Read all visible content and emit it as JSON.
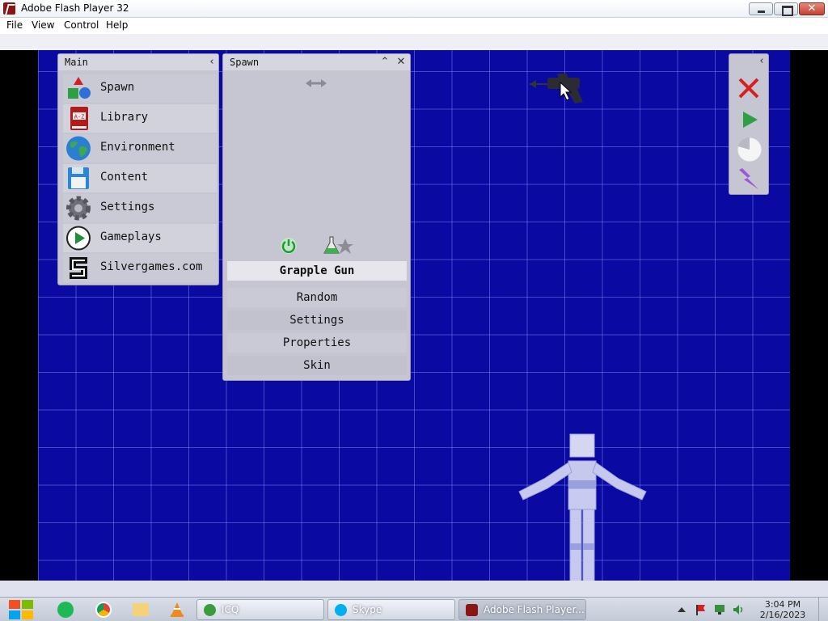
{
  "window": {
    "title": "Adobe Flash Player 32",
    "menu": [
      "File",
      "View",
      "Control",
      "Help"
    ],
    "close_glyph": "✕"
  },
  "main_panel": {
    "title": "Main",
    "collapse_glyph": "‹",
    "items": [
      {
        "label": "Spawn",
        "icon": "shapes-icon"
      },
      {
        "label": "Library",
        "icon": "book-a-z-icon"
      },
      {
        "label": "Environment",
        "icon": "globe-icon"
      },
      {
        "label": "Content",
        "icon": "floppy-disk-icon"
      },
      {
        "label": "Settings",
        "icon": "gear-icon"
      },
      {
        "label": "Gameplays",
        "icon": "play-circle-icon"
      },
      {
        "label": "Silvergames.com",
        "icon": "silvergames-logo-icon"
      }
    ]
  },
  "spawn_panel": {
    "title": "Spawn",
    "collapse_glyph": "⌃",
    "close_glyph": "✕",
    "selected_item": "Grapple Gun",
    "buttons": [
      "Random",
      "Settings",
      "Properties",
      "Skin"
    ]
  },
  "tools_panel": {
    "collapse_glyph": "‹",
    "tools": [
      "delete-x-icon",
      "play-icon",
      "time-pie-icon",
      "lightning-icon"
    ]
  },
  "taskbar": {
    "apps": [
      {
        "label": "ICQ",
        "active": false
      },
      {
        "label": "Skype",
        "active": false
      },
      {
        "label": "Adobe Flash Player...",
        "active": true
      }
    ],
    "clock_time": "3:04 PM",
    "clock_date": "2/16/2023"
  }
}
